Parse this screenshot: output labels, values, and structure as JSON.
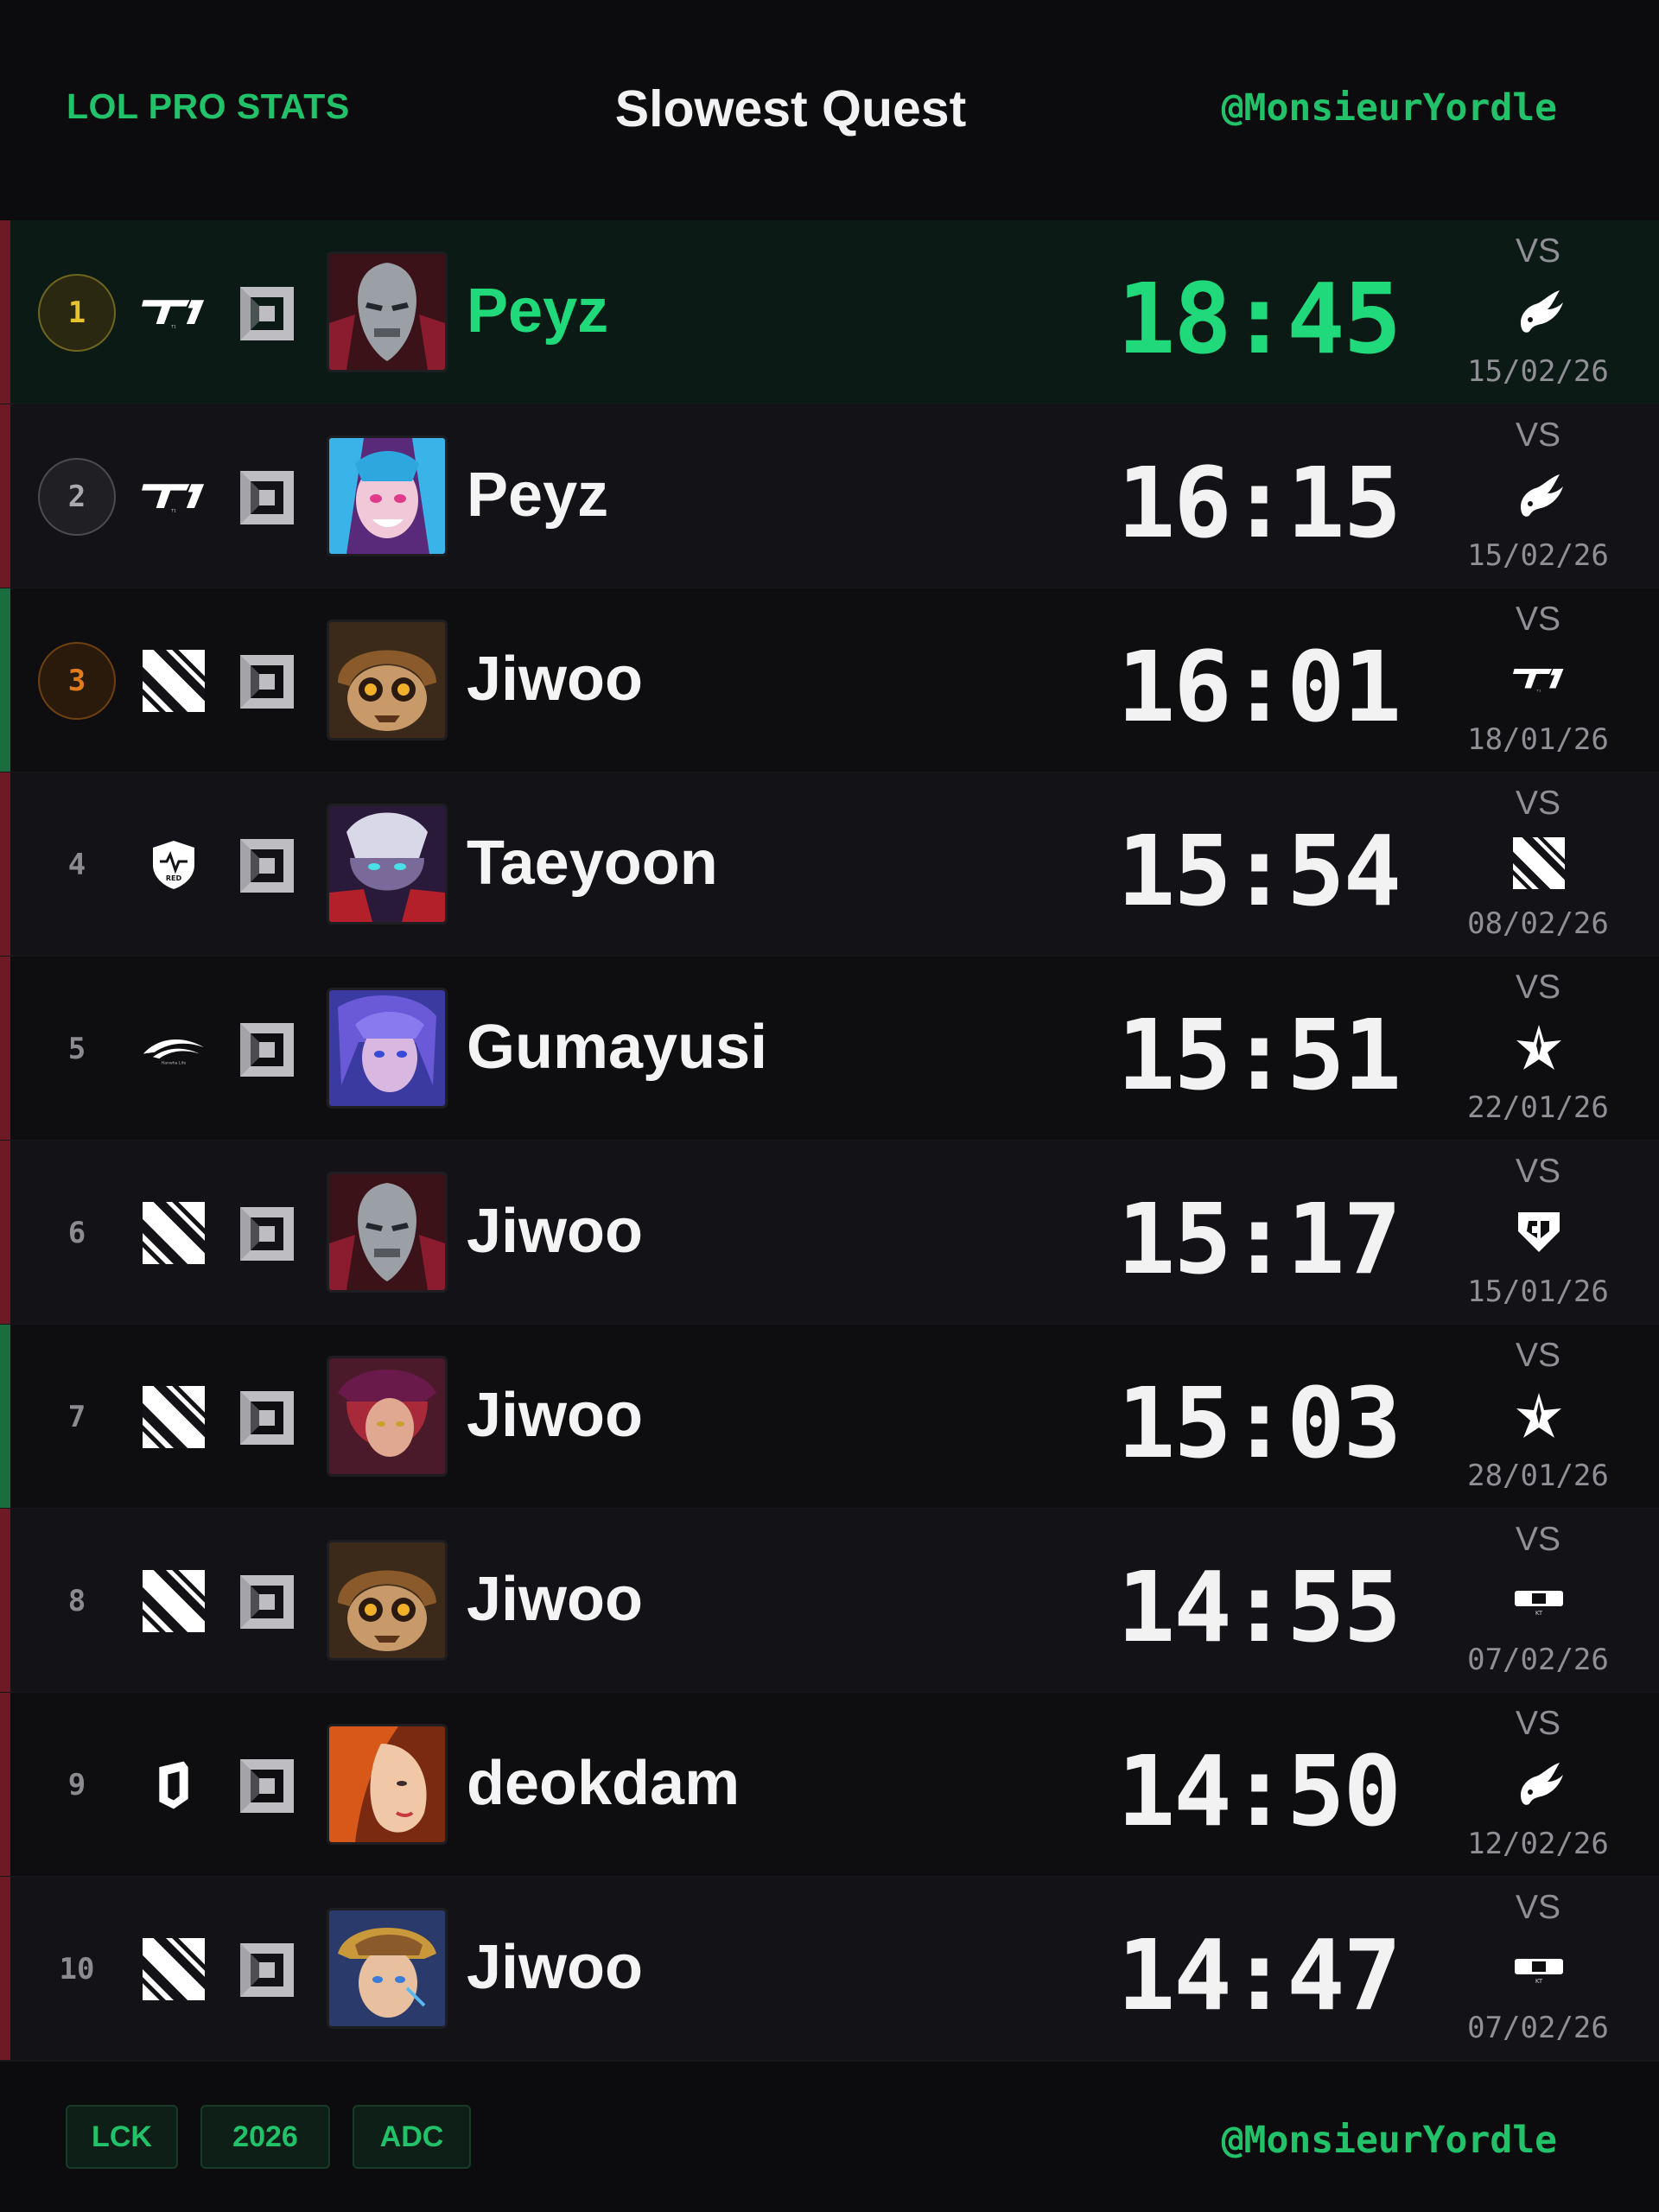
{
  "header": {
    "brand": "LOL PRO STATS",
    "title": "Slowest Quest",
    "handle": "@MonsieurYordle"
  },
  "vs_label": "VS",
  "rows": [
    {
      "rank": "1",
      "player": "Peyz",
      "time": "18:45",
      "date": "15/02/26",
      "team": "t1-logo-icon",
      "opponent": "rabbit-logo-icon",
      "champion": "jhin-portrait",
      "bar": "red"
    },
    {
      "rank": "2",
      "player": "Peyz",
      "time": "16:15",
      "date": "15/02/26",
      "team": "t1-logo-icon",
      "opponent": "rabbit-logo-icon",
      "champion": "jinx-portrait",
      "bar": "red"
    },
    {
      "rank": "3",
      "player": "Jiwoo",
      "time": "16:01",
      "date": "18/01/26",
      "team": "stripes-logo-icon",
      "opponent": "t1-logo-icon",
      "champion": "ziggs-portrait",
      "bar": "green"
    },
    {
      "rank": "4",
      "player": "Taeyoon",
      "time": "15:54",
      "date": "08/02/26",
      "team": "shield-logo-icon",
      "opponent": "stripes-logo-icon",
      "champion": "aphelios-portrait",
      "bar": "red"
    },
    {
      "rank": "5",
      "player": "Gumayusi",
      "time": "15:51",
      "date": "22/01/26",
      "team": "swoosh-logo-icon",
      "opponent": "star-logo-icon",
      "champion": "sylas-portrait",
      "bar": "red"
    },
    {
      "rank": "6",
      "player": "Jiwoo",
      "time": "15:17",
      "date": "15/01/26",
      "team": "stripes-logo-icon",
      "opponent": "geng-logo-icon",
      "champion": "jhin-portrait",
      "bar": "red"
    },
    {
      "rank": "7",
      "player": "Jiwoo",
      "time": "15:03",
      "date": "28/01/26",
      "team": "stripes-logo-icon",
      "opponent": "star-logo-icon",
      "champion": "xayah-portrait",
      "bar": "green"
    },
    {
      "rank": "8",
      "player": "Jiwoo",
      "time": "14:55",
      "date": "07/02/26",
      "team": "stripes-logo-icon",
      "opponent": "kt-logo-icon",
      "champion": "ziggs-portrait",
      "bar": "red"
    },
    {
      "rank": "9",
      "player": "deokdam",
      "time": "14:50",
      "date": "12/02/26",
      "team": "d-shield-logo-icon",
      "opponent": "rabbit-logo-icon",
      "champion": "miss-fortune-portrait",
      "bar": "red"
    },
    {
      "rank": "10",
      "player": "Jiwoo",
      "time": "14:47",
      "date": "07/02/26",
      "team": "stripes-logo-icon",
      "opponent": "kt-logo-icon",
      "champion": "ezreal-portrait",
      "bar": "red"
    }
  ],
  "footer": {
    "tags": [
      "LCK",
      "2026",
      "ADC"
    ],
    "handle": "@MonsieurYordle"
  },
  "colors": {
    "accent": "#22c26a",
    "gold": "#e7c22b",
    "bronze": "#e07c1a",
    "loss_bar": "#6e1a26",
    "win_bar": "#1a6d3e"
  }
}
